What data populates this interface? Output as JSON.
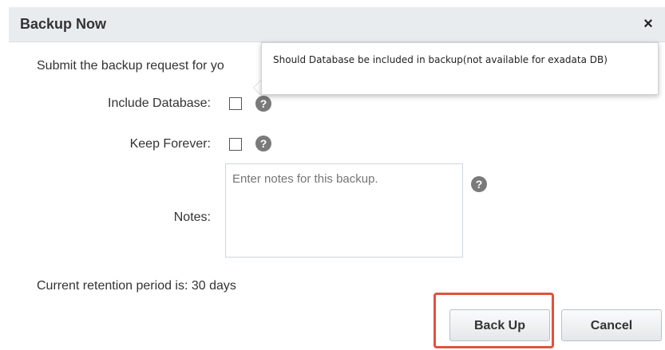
{
  "dialog": {
    "title": "Backup Now",
    "close_glyph": "×",
    "intro_text": "Submit the backup request for yo"
  },
  "form": {
    "include_database_label": "Include Database:",
    "keep_forever_label": "Keep Forever:",
    "notes_label": "Notes:",
    "notes_placeholder": "Enter notes for this backup.",
    "help_glyph": "?",
    "include_database_checked": false,
    "keep_forever_checked": false
  },
  "tooltip": {
    "text": "Should Database be included in backup(not available for exadata DB)"
  },
  "retention": {
    "text": "Current retention period is: 30 days"
  },
  "buttons": {
    "back_up_label": "Back Up",
    "cancel_label": "Cancel"
  },
  "colors": {
    "highlight": "#e0533b",
    "titlebar": "#e9ecef",
    "help_icon": "#7a7a7a"
  },
  "icons": {
    "close": "close-icon",
    "help": "help-icon"
  }
}
